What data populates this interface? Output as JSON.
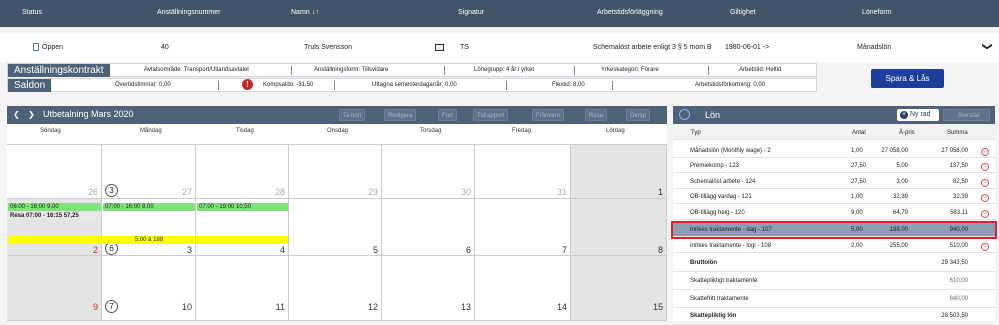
{
  "header": {
    "columns": [
      "Status",
      "Anställningsnummer",
      "Namn",
      "Signatur",
      "Arbetstidsförläggning",
      "Giltighet",
      "Löneform"
    ],
    "sort_glyph": "↓↑"
  },
  "employee": {
    "status": "Öppen",
    "number": "40",
    "name": "Truls Svensson",
    "signature": "TS",
    "schedule": "Schemalöst arbete enligt 3 § 5 mom B",
    "validity": "1980-06-01 ->",
    "salary_form": "Månadslön",
    "chevron": "❯"
  },
  "contract": {
    "label": "Anställningskontrakt",
    "fields": [
      "Avtalsområde: Transport/Utlandsavtalet",
      "Anställningsform: Tillsvidare",
      "Lönegrupp: 4 år i yrket",
      "Yrkeskategori: Förare",
      "Arbetstid: Heltid"
    ]
  },
  "balances": {
    "label": "Saldon",
    "overtime": "Övertidstimmar: 0,00",
    "warning": "!",
    "comp": "Kompsaldo: -31,50",
    "vacation": "Uttagna semesterdagar/år: 0,00",
    "flex": "Flextid: 8,00",
    "worktime_reduction": "Arbetstidsförkortning: 0,00"
  },
  "save_button": "Spara & Lås",
  "calendar": {
    "prev": "❮",
    "next": "❯",
    "title": "Utbetalning Mars 2020",
    "toolbar": [
      "Ta bort",
      "Redigera",
      "Fort",
      "Tidrapport",
      "Frånvaro",
      "Resa",
      "Övrigt"
    ],
    "weekdays": [
      "Söndag",
      "Måndag",
      "Tisdag",
      "Onsdag",
      "Torsdag",
      "Fredag",
      "Lördag"
    ],
    "week1_days": [
      "26",
      "3",
      "27",
      "28",
      "29",
      "30",
      "31",
      "1"
    ],
    "week2_days": [
      "2",
      "6",
      "3",
      "4",
      "5",
      "6",
      "7",
      "8"
    ],
    "week3_days": [
      "9",
      "7",
      "10",
      "11",
      "12",
      "13",
      "14",
      "15"
    ],
    "events": {
      "sun_shift": "06:00 - 16:00 9,00",
      "sun_travel": "Resa 07:00 - 16:15 57,25",
      "mon_shift": "07:00 - 16:00 8,00",
      "tue_shift": "07:00 - 19:00 10,50",
      "allowance": "5,00 à 188"
    }
  },
  "salary": {
    "title": "Lön",
    "new_row": "Ny rad",
    "restore": "Återställ",
    "columns": [
      "Typ",
      "Antal",
      "À-pris",
      "Summa"
    ],
    "rows": [
      {
        "type": "Månadslön (Monthly wage) - 2",
        "qty": "1,00",
        "price": "27 058,00",
        "sum": "27 058,00"
      },
      {
        "type": "Premiekomp - 123",
        "qty": "27,50",
        "price": "5,00",
        "sum": "137,50"
      },
      {
        "type": "Schemalöst arbete - 124",
        "qty": "27,50",
        "price": "3,00",
        "sum": "82,50"
      },
      {
        "type": "OB-tillägg vardag - 121",
        "qty": "1,00",
        "price": "32,39",
        "sum": "32,39"
      },
      {
        "type": "OB-tillägg helg - 120",
        "qty": "9,00",
        "price": "64,79",
        "sum": "583,11"
      },
      {
        "type": "Inrikes traktamente - dag - 107",
        "qty": "5,00",
        "price": "188,00",
        "sum": "940,00"
      },
      {
        "type": "Inrikes traktamente - logi - 108",
        "qty": "2,00",
        "price": "255,00",
        "sum": "510,00"
      }
    ],
    "summary": [
      {
        "label": "Bruttolön",
        "value": "29 343,50"
      },
      {
        "label": "Skattepliktigt traktamente",
        "value": "610,00"
      },
      {
        "label": "Skattefritt traktamente",
        "value": "840,00"
      },
      {
        "label": "Skattepliktig lön",
        "value": "28 503,50"
      }
    ],
    "remove_glyph": "−"
  },
  "colors": {
    "header": "#43536a",
    "panel": "#4d6178",
    "accent": "#1d3f99",
    "shift": "#7de37a",
    "allowance": "#ffff00",
    "highlight_border": "#e0202a"
  }
}
